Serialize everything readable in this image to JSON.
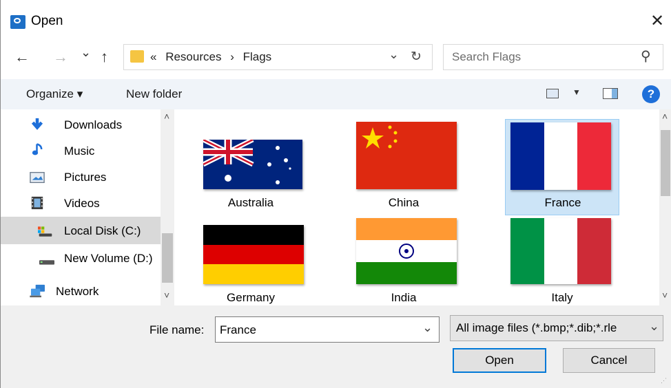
{
  "window": {
    "title": "Open",
    "close_glyph": "✕"
  },
  "nav": {
    "back_glyph": "←",
    "forward_glyph": "→",
    "recent_glyph": "⌄",
    "up_glyph": "↑",
    "breadcrumb_sep": "«",
    "breadcrumbs": [
      "Resources",
      "›",
      "Flags"
    ],
    "address_dropdown_glyph": "⌄",
    "refresh_glyph": "↻",
    "search_placeholder": "Search Flags",
    "search_glyph": "⚲"
  },
  "command_bar": {
    "organize_label": "Organize ▾",
    "new_folder_label": "New folder",
    "help_glyph": "?"
  },
  "sidebar": {
    "items": [
      {
        "label": "Downloads",
        "icon": "downloads-icon"
      },
      {
        "label": "Music",
        "icon": "music-icon"
      },
      {
        "label": "Pictures",
        "icon": "pictures-icon"
      },
      {
        "label": "Videos",
        "icon": "videos-icon"
      },
      {
        "label": "Local Disk (C:)",
        "icon": "local-disk-icon",
        "selected": true
      },
      {
        "label": "New Volume (D:)",
        "icon": "drive-icon"
      },
      {
        "label": "Network",
        "icon": "network-icon"
      }
    ],
    "scroll_up_glyph": "˄",
    "scroll_down_glyph": "˅"
  },
  "files": [
    {
      "label": "Australia",
      "icon": "australia-flag-icon"
    },
    {
      "label": "China",
      "icon": "china-flag-icon"
    },
    {
      "label": "France",
      "icon": "france-flag-icon",
      "selected": true
    },
    {
      "label": "Germany",
      "icon": "germany-flag-icon"
    },
    {
      "label": "India",
      "icon": "india-flag-icon"
    },
    {
      "label": "Italy",
      "icon": "italy-flag-icon"
    }
  ],
  "footer": {
    "filename_label": "File name:",
    "filename_value": "France",
    "filename_dropdown_glyph": "⌄",
    "filetype_value": "All image files (*.bmp;*.dib;*.rle",
    "filetype_dropdown_glyph": "⌄",
    "open_label": "Open",
    "cancel_label": "Cancel"
  },
  "colors": {
    "accent": "#0078d7",
    "selection": "#cce4f7",
    "command_bar_bg": "#f0f4f9"
  }
}
